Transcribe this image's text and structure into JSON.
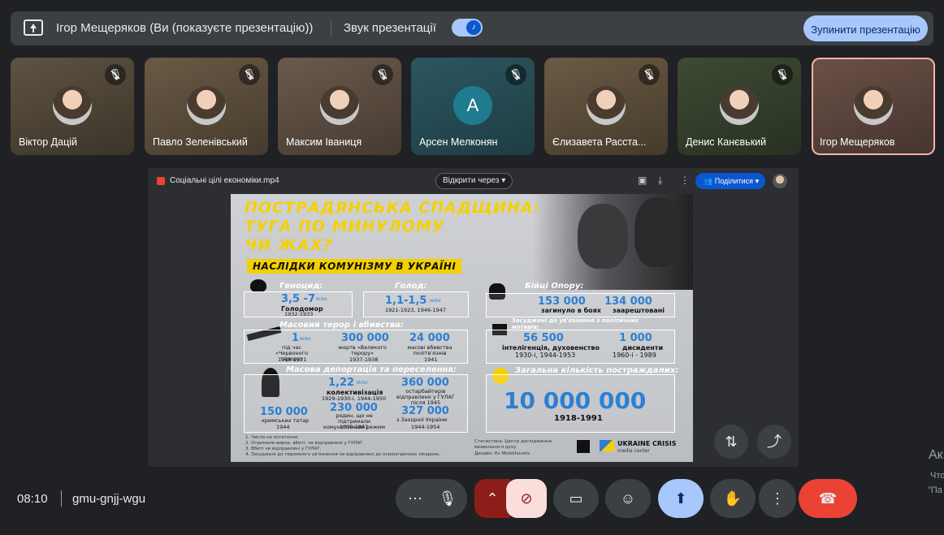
{
  "banner": {
    "presenter": "Ігор Мещеряков (Ви (показуєте презентацію))",
    "sound_label": "Звук презентації",
    "stop_button": "Зупинити презентацію"
  },
  "participants": [
    {
      "name": "Віктор Дацій",
      "muted": true
    },
    {
      "name": "Павло Зеленівський",
      "muted": true
    },
    {
      "name": "Максим Іваниця",
      "muted": true
    },
    {
      "name": "Арсен Мелконян",
      "muted": true,
      "initial": "A"
    },
    {
      "name": "Єлизавета Расста...",
      "muted": true
    },
    {
      "name": "Денис Канєвький",
      "muted": true
    },
    {
      "name": "Ігор Мещеряков",
      "muted": false
    }
  ],
  "presentation": {
    "file_name": "Соціальні цілі економіки.mp4",
    "open_with": "Відкрити через",
    "share": "Поділитися",
    "slide": {
      "title_lines": [
        "ПОСТРАДЯНСЬКА СПАДЩИНА:",
        "ТУГА ПО МИНУЛОМУ",
        "ЧИ ЖАХ?"
      ],
      "subtitle": "НАСЛІДКИ КОМУНІЗМУ В УКРАЇНІ",
      "genocide": {
        "label": "Геноцид:",
        "value": "3,5 -7",
        "unit": "млн",
        "note": "Голодомор",
        "years": "1932-1933"
      },
      "famine": {
        "label": "Голод:",
        "value": "1,1-1,5",
        "unit": "млн",
        "years": "1921-1923, 1946-1947"
      },
      "fighters": {
        "label": "Бійці Опору:",
        "v1": "153 000",
        "n1": "загинуло в боях",
        "v2": "134 000",
        "n2": "заарештовані"
      },
      "terror": {
        "label": "Масовий терор і вбивства:",
        "v1": "1",
        "u1": "млн",
        "n1": "під час «Червоного терору»",
        "y1": "1918-1921",
        "v2": "300 000",
        "n2": "жертв «Великого терору»",
        "y2": "1937-1938",
        "v3": "24 000",
        "n3": "масові вбивства політв'язнів",
        "y3": "1941"
      },
      "political": {
        "label": "Засуджені до ув'язнення з політичних мотивів:",
        "v1": "56 500",
        "n1": "інтелігенція, духовенство",
        "y1": "1930-і, 1944-1953",
        "v2": "1 000",
        "n2": "дисиденти",
        "y2": "1960-і - 1989"
      },
      "deport": {
        "label": "Масова депортація та переселення:",
        "v1": "1,22",
        "u1": "млн",
        "n1": "колективізація",
        "y1": "1929-1930-і, 1944-1950",
        "v2": "360 000",
        "n2": "остарбайтерів відправлено у ГУЛАГ після 1945",
        "v3": "150 000",
        "n3": "кримських татар",
        "y3": "1944",
        "v4": "230 000",
        "n4": "родин, що не підтримали комуністичний режим",
        "y4": "1939-1941",
        "v5": "327 000",
        "n5": "з Західної України",
        "y5": "1944-1954"
      },
      "total": {
        "label": "Загальна кількість постраждалих:",
        "value": "10 000 000",
        "years": "1918-1991"
      },
      "footnotes": [
        "1. Число не остаточне.",
        "2. Отримали вирок, вбиті, чи відправлені у ГУЛАГ.",
        "3. Вбиті чи відправлені у ГУЛАГ.",
        "4. Засуджені до тюремного ув'язнення чи відправлені до психіатричних лікарень."
      ],
      "credits": [
        "Статистика: Центр дослідження визвольного руху",
        "Дизайн: Ev Molokhovets"
      ],
      "org": "UKRAINE CRISIS",
      "org_sub": "media center"
    }
  },
  "bottom": {
    "time": "08:10",
    "meeting_code": "gmu-gnjj-wgu"
  },
  "edge": {
    "t1": "Ак",
    "t2": "Что",
    "t3": "\"Па"
  }
}
